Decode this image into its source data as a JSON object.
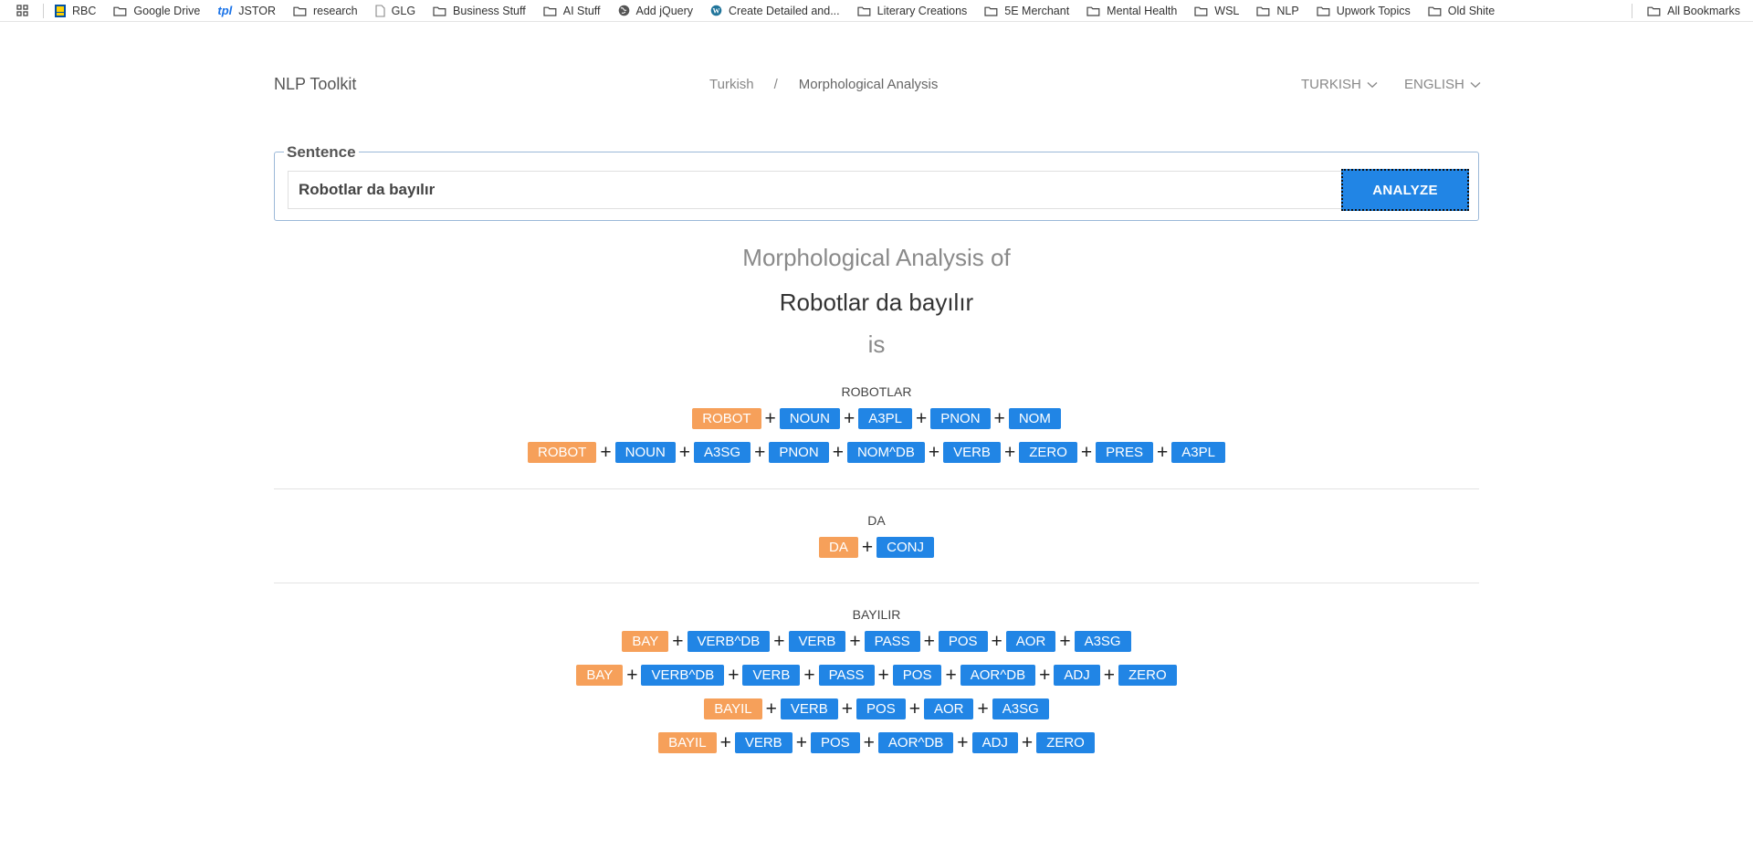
{
  "bookmarks": {
    "items": [
      {
        "label": "RBC",
        "icon": "rbc-logo-icon"
      },
      {
        "label": "Google Drive",
        "icon": "folder-icon"
      },
      {
        "label": "JSTOR",
        "icon": "tpl-logo-icon"
      },
      {
        "label": "research",
        "icon": "folder-icon"
      },
      {
        "label": "GLG",
        "icon": "page-icon"
      },
      {
        "label": "Business Stuff",
        "icon": "folder-icon"
      },
      {
        "label": "AI Stuff",
        "icon": "folder-icon"
      },
      {
        "label": "Add jQuery",
        "icon": "globe-icon"
      },
      {
        "label": "Create Detailed and...",
        "icon": "wordpress-icon"
      },
      {
        "label": "Literary Creations",
        "icon": "folder-icon"
      },
      {
        "label": "5E Merchant",
        "icon": "folder-icon"
      },
      {
        "label": "Mental Health",
        "icon": "folder-icon"
      },
      {
        "label": "WSL",
        "icon": "folder-icon"
      },
      {
        "label": "NLP",
        "icon": "folder-icon"
      },
      {
        "label": "Upwork Topics",
        "icon": "folder-icon"
      },
      {
        "label": "Old Shite",
        "icon": "folder-icon"
      }
    ],
    "all_bookmarks": "All Bookmarks",
    "tpl_logo_text": "tpl"
  },
  "header": {
    "brand": "NLP Toolkit",
    "breadcrumb": [
      "Turkish",
      "/",
      "Morphological Analysis"
    ],
    "language_menu": "TURKISH",
    "ui_language_menu": "ENGLISH"
  },
  "form": {
    "legend": "Sentence",
    "sentence_value": "Robotlar da bayılır",
    "analyze_label": "ANALYZE"
  },
  "results": {
    "heading": "Morphological Analysis of",
    "sentence": "Robotlar da bayılır",
    "suffix": "is",
    "plus_sign": "+",
    "words": [
      {
        "word": "ROBOTLAR",
        "parses": [
          [
            "ROBOT",
            "NOUN",
            "A3PL",
            "PNON",
            "NOM"
          ],
          [
            "ROBOT",
            "NOUN",
            "A3SG",
            "PNON",
            "NOM^DB",
            "VERB",
            "ZERO",
            "PRES",
            "A3PL"
          ]
        ]
      },
      {
        "word": "DA",
        "parses": [
          [
            "DA",
            "CONJ"
          ]
        ]
      },
      {
        "word": "BAYILIR",
        "parses": [
          [
            "BAY",
            "VERB^DB",
            "VERB",
            "PASS",
            "POS",
            "AOR",
            "A3SG"
          ],
          [
            "BAY",
            "VERB^DB",
            "VERB",
            "PASS",
            "POS",
            "AOR^DB",
            "ADJ",
            "ZERO"
          ],
          [
            "BAYIL",
            "VERB",
            "POS",
            "AOR",
            "A3SG"
          ],
          [
            "BAYIL",
            "VERB",
            "POS",
            "AOR^DB",
            "ADJ",
            "ZERO"
          ]
        ]
      }
    ]
  },
  "colors": {
    "root_tag": "#f6a05a",
    "feature_tag": "#2185e5",
    "analyze_button": "#2185e5"
  }
}
